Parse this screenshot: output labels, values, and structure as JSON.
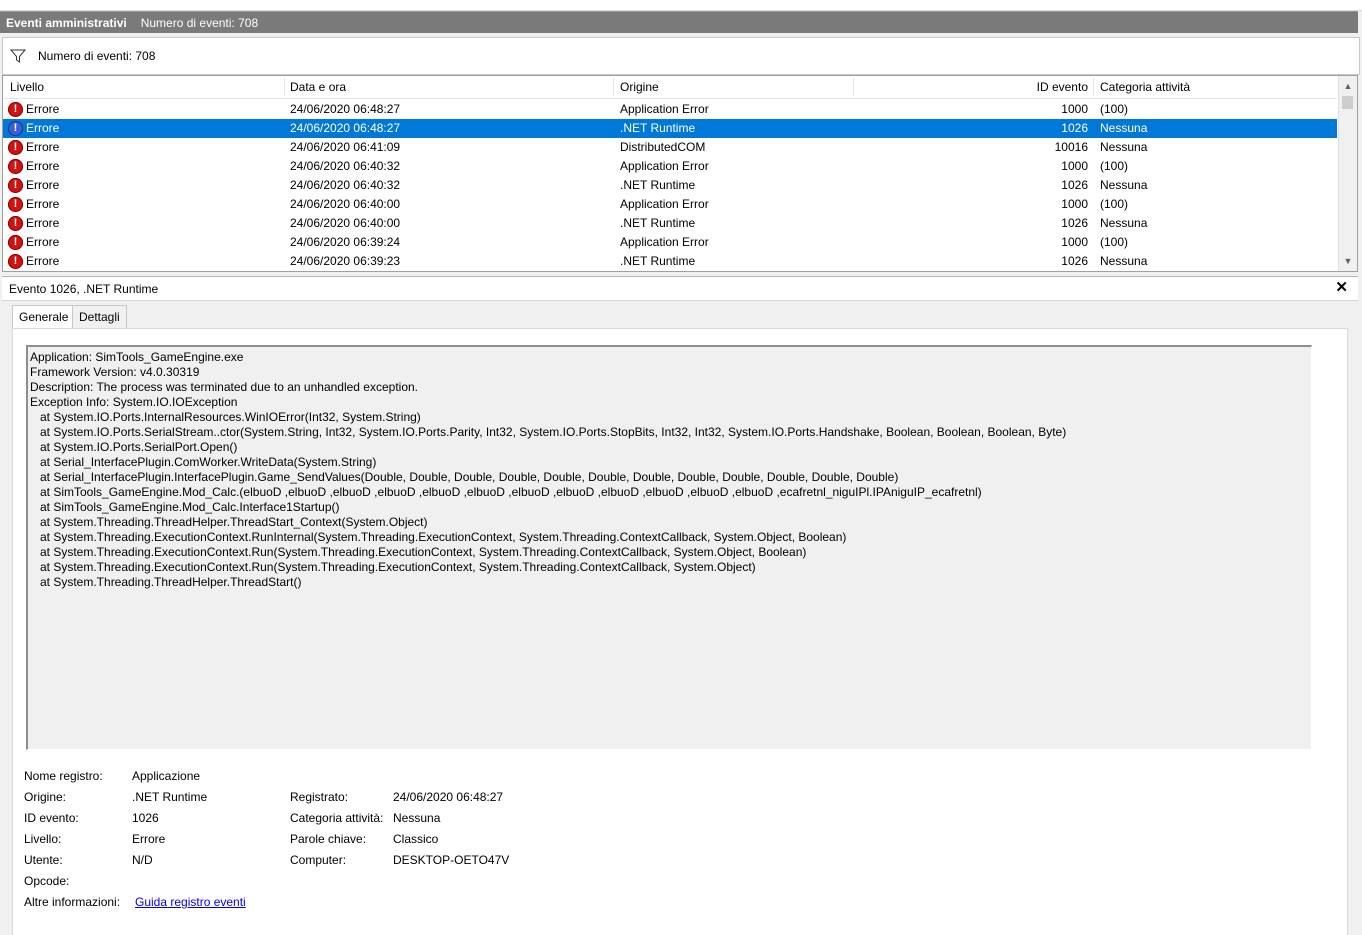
{
  "title": {
    "section": "Eventi amministrativi",
    "count": "Numero di eventi: 708"
  },
  "filter": {
    "text": "Numero di eventi: 708",
    "icon": "filter-icon"
  },
  "table": {
    "columns": [
      "Livello",
      "Data e ora",
      "Origine",
      "ID evento",
      "Categoria attività"
    ],
    "rows": [
      {
        "level": "Errore",
        "date": "24/06/2020 06:48:27",
        "source": "Application Error",
        "id": "1000",
        "category": "(100)"
      },
      {
        "level": "Errore",
        "date": "24/06/2020 06:48:27",
        "source": ".NET Runtime",
        "id": "1026",
        "category": "Nessuna",
        "selected": true
      },
      {
        "level": "Errore",
        "date": "24/06/2020 06:41:09",
        "source": "DistributedCOM",
        "id": "10016",
        "category": "Nessuna"
      },
      {
        "level": "Errore",
        "date": "24/06/2020 06:40:32",
        "source": "Application Error",
        "id": "1000",
        "category": "(100)"
      },
      {
        "level": "Errore",
        "date": "24/06/2020 06:40:32",
        "source": ".NET Runtime",
        "id": "1026",
        "category": "Nessuna"
      },
      {
        "level": "Errore",
        "date": "24/06/2020 06:40:00",
        "source": "Application Error",
        "id": "1000",
        "category": "(100)"
      },
      {
        "level": "Errore",
        "date": "24/06/2020 06:40:00",
        "source": ".NET Runtime",
        "id": "1026",
        "category": "Nessuna"
      },
      {
        "level": "Errore",
        "date": "24/06/2020 06:39:24",
        "source": "Application Error",
        "id": "1000",
        "category": "(100)"
      },
      {
        "level": "Errore",
        "date": "24/06/2020 06:39:23",
        "source": ".NET Runtime",
        "id": "1026",
        "category": "Nessuna"
      }
    ]
  },
  "detail": {
    "title": "Evento 1026, .NET Runtime",
    "close": "✕",
    "tabs": [
      "Generale",
      "Dettagli"
    ],
    "description": [
      "Application: SimTools_GameEngine.exe",
      "Framework Version: v4.0.30319",
      "Description: The process was terminated due to an unhandled exception.",
      "Exception Info: System.IO.IOException",
      "   at System.IO.Ports.InternalResources.WinIOError(Int32, System.String)",
      "   at System.IO.Ports.SerialStream..ctor(System.String, Int32, System.IO.Ports.Parity, Int32, System.IO.Ports.StopBits, Int32, Int32, System.IO.Ports.Handshake, Boolean, Boolean, Boolean, Byte)",
      "   at System.IO.Ports.SerialPort.Open()",
      "   at Serial_InterfacePlugin.ComWorker.WriteData(System.String)",
      "   at Serial_InterfacePlugin.InterfacePlugin.Game_SendValues(Double, Double, Double, Double, Double, Double, Double, Double, Double, Double, Double, Double)",
      "   at SimTools_GameEngine.Mod_Calc.(elbuoD ,elbuoD ,elbuoD ,elbuoD ,elbuoD ,elbuoD ,elbuoD ,elbuoD ,elbuoD ,elbuoD ,elbuoD ,elbuoD ,ecafretnl_niguIPl.IPAniguIP_ecafretnl)",
      "   at SimTools_GameEngine.Mod_Calc.Interface1Startup()",
      "   at System.Threading.ThreadHelper.ThreadStart_Context(System.Object)",
      "   at System.Threading.ExecutionContext.RunInternal(System.Threading.ExecutionContext, System.Threading.ContextCallback, System.Object, Boolean)",
      "   at System.Threading.ExecutionContext.Run(System.Threading.ExecutionContext, System.Threading.ContextCallback, System.Object, Boolean)",
      "   at System.Threading.ExecutionContext.Run(System.Threading.ExecutionContext, System.Threading.ContextCallback, System.Object)",
      "   at System.Threading.ThreadHelper.ThreadStart()"
    ],
    "props": {
      "log_name_label": "Nome registro:",
      "log_name": "Applicazione",
      "source_label": "Origine:",
      "source": ".NET Runtime",
      "logged_label": "Registrato:",
      "logged": "24/06/2020 06:48:27",
      "event_id_label": "ID evento:",
      "event_id": "1026",
      "task_label": "Categoria attività:",
      "task": "Nessuna",
      "level_label": "Livello:",
      "level": "Errore",
      "keywords_label": "Parole chiave:",
      "keywords": "Classico",
      "user_label": "Utente:",
      "user": "N/D",
      "computer_label": "Computer:",
      "computer": "DESKTOP-OETO47V",
      "opcode_label": "Opcode:",
      "more_info_label": "Altre informazioni:",
      "more_info_link": "Guida registro eventi"
    }
  },
  "colors": {
    "selection": "#0078d7",
    "error": "#d01212",
    "titlebar": "#7a7a7a",
    "link": "#0000ee"
  }
}
